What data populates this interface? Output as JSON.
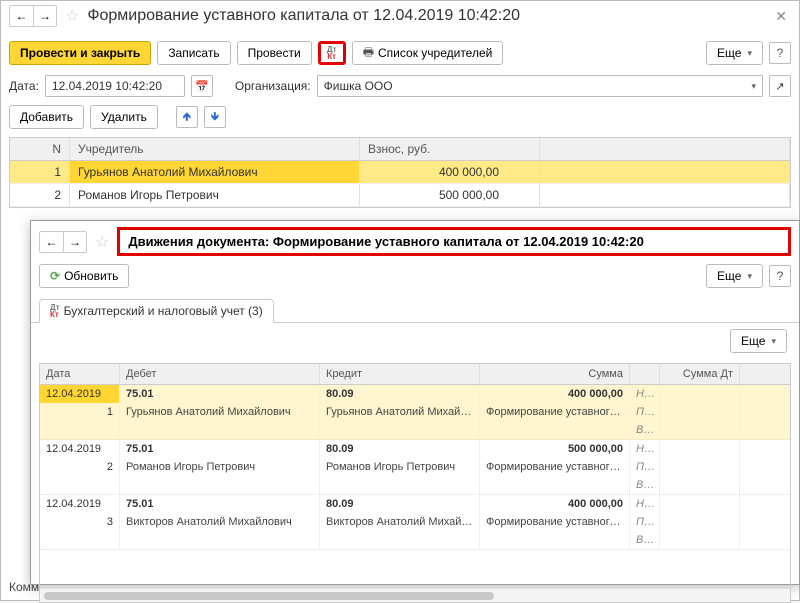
{
  "header": {
    "title": "Формирование уставного капитала от 12.04.2019 10:42:20"
  },
  "toolbar": {
    "post_close": "Провести и закрыть",
    "save": "Записать",
    "post": "Провести",
    "founders_list": "Список учредителей",
    "more": "Еще"
  },
  "form": {
    "date_label": "Дата:",
    "date_value": "12.04.2019 10:42:20",
    "org_label": "Организация:",
    "org_value": "Фишка ООО"
  },
  "grid_toolbar": {
    "add": "Добавить",
    "delete": "Удалить"
  },
  "grid": {
    "columns": {
      "n": "N",
      "founder": "Учредитель",
      "amount": "Взнос, руб."
    },
    "rows": [
      {
        "n": "1",
        "founder": "Гурьянов Анатолий Михайлович",
        "amount": "400 000,00",
        "selected": true
      },
      {
        "n": "2",
        "founder": "Романов Игорь Петрович",
        "amount": "500 000,00",
        "selected": false
      }
    ]
  },
  "inner": {
    "title": "Движения документа: Формирование уставного капитала от 12.04.2019 10:42:20",
    "refresh": "Обновить",
    "more": "Еще",
    "tab_label": "Бухгалтерский и налоговый учет (3)"
  },
  "mv": {
    "columns": {
      "date": "Дата",
      "debit": "Дебет",
      "credit": "Кредит",
      "sum": "Сумма",
      "sumdt": "Сумма Дт"
    },
    "flags": {
      "nu": "НУ:",
      "pr": "ПР:",
      "vr": "ВР:"
    },
    "entries": [
      {
        "date": "12.04.2019",
        "n": "1",
        "debit_acct": "75.01",
        "debit_sub": "Гурьянов Анатолий Михайлович",
        "credit_acct": "80.09",
        "credit_sub": "Гурьянов Анатолий Михайлович",
        "sum": "400 000,00",
        "desc": "Формирование уставного капитала",
        "selected": true
      },
      {
        "date": "12.04.2019",
        "n": "2",
        "debit_acct": "75.01",
        "debit_sub": "Романов Игорь Петрович",
        "credit_acct": "80.09",
        "credit_sub": "Романов Игорь Петрович",
        "sum": "500 000,00",
        "desc": "Формирование уставного капитала",
        "selected": false
      },
      {
        "date": "12.04.2019",
        "n": "3",
        "debit_acct": "75.01",
        "debit_sub": "Викторов Анатолий Михайлович",
        "credit_acct": "80.09",
        "credit_sub": "Викторов Анатолий Михайлович",
        "sum": "400 000,00",
        "desc": "Формирование уставного капитала",
        "selected": false
      }
    ]
  },
  "footer": {
    "comment_label": "Комм"
  }
}
